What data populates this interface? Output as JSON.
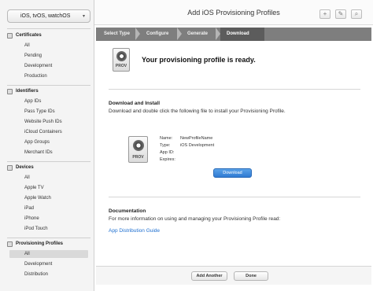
{
  "sidebar": {
    "platform": "iOS, tvOS, watchOS",
    "sections": [
      {
        "label": "Certificates",
        "items": [
          "All",
          "Pending",
          "Development",
          "Production"
        ]
      },
      {
        "label": "Identifiers",
        "items": [
          "App IDs",
          "Pass Type IDs",
          "Website Push IDs",
          "iCloud Containers",
          "App Groups",
          "Merchant IDs"
        ]
      },
      {
        "label": "Devices",
        "items": [
          "All",
          "Apple TV",
          "Apple Watch",
          "iPad",
          "iPhone",
          "iPod Touch"
        ]
      },
      {
        "label": "Provisioning Profiles",
        "items": [
          "All",
          "Development",
          "Distribution"
        ]
      }
    ],
    "active_item": "Provisioning Profiles / All"
  },
  "header": {
    "title": "Add iOS Provisioning Profiles",
    "add_symbol": "+",
    "edit_symbol": "✎",
    "search_symbol": "⌕"
  },
  "steps": [
    "Select Type",
    "Configure",
    "Generate",
    "Download"
  ],
  "main": {
    "ready_message": "Your provisioning profile is ready.",
    "icon_label": "PROV",
    "download": {
      "title": "Download and Install",
      "description": "Download and double click the following file to install your Provisioning Profile.",
      "name_label": "Name:",
      "name_value": "NewProfileName",
      "type_label": "Type:",
      "type_value": "iOS Development",
      "appid_label": "App ID:",
      "appid_value": "",
      "expires_label": "Expires:",
      "expires_value": "",
      "button": "Download"
    },
    "documentation": {
      "title": "Documentation",
      "description": "For more information on using and managing your Provisioning Profile read:",
      "link": "App Distribution Guide"
    }
  },
  "footer": {
    "add_another": "Add Another",
    "done": "Done"
  },
  "colors": {
    "accent": "#2f7ad3",
    "link": "#1e6fd0",
    "steps_bar": "#7e7e7e"
  }
}
